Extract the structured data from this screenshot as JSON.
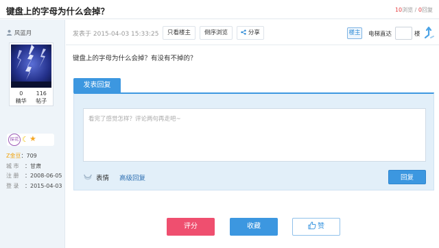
{
  "header": {
    "title": "键盘上的字母为什么会掉？",
    "views": "10",
    "views_label": "浏览",
    "separator": " / ",
    "replies": "0",
    "replies_label": "回复"
  },
  "author": {
    "name": "风蓝月",
    "jinghua_count": "0",
    "jinghua_label": "精华",
    "posts_count": "116",
    "posts_label": "帖子",
    "badge_text": "探花",
    "gold_label": "Z金豆",
    "gold_value": "709",
    "city_label": "城 市",
    "city_value": "甘肃",
    "register_label": "注 册",
    "register_value": "2008-06-05",
    "login_label": "登 录",
    "login_value": "2015-04-03"
  },
  "post_header": {
    "date": "发表于 2015-04-03 15:33:25",
    "only_op_label": "只看楼主",
    "reverse_label": "倒序浏览",
    "share_label": "分享",
    "op_badge": "楼主",
    "elevator_label": "电梯直达",
    "elevator_value": "",
    "floor_label": "楼"
  },
  "post": {
    "content": "键盘上的字母为什么会掉？有没有不掉的？"
  },
  "reply": {
    "tab_label": "发表回复",
    "placeholder": "看完了感觉怎样？评论两句再走吧~",
    "emoji_label": "表情",
    "advanced_label": "高级回复",
    "submit_label": "回复"
  },
  "actions": {
    "rate_label": "评分",
    "favorite_label": "收藏",
    "like_label": "赞"
  }
}
